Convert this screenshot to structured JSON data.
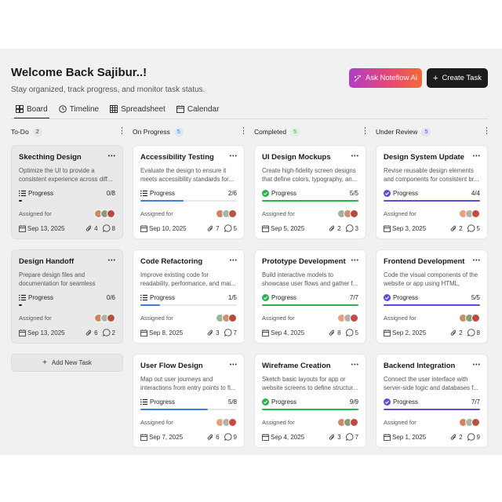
{
  "header": {
    "title": "Welcome Back Sajibur..!",
    "subtitle": "Stay organized, track progress, and monitor task status.",
    "ask_label": "Ask Noteflow Ai",
    "create_label": "Create Task"
  },
  "tabs": [
    {
      "label": "Board",
      "icon": "board-icon",
      "active": true
    },
    {
      "label": "Timeline",
      "icon": "clock-icon",
      "active": false
    },
    {
      "label": "Spreadsheet",
      "icon": "grid-icon",
      "active": false
    },
    {
      "label": "Calendar",
      "icon": "calendar-icon",
      "active": false
    }
  ],
  "colors": {
    "todo_bar": "#1c1c1c",
    "progress_bar": "#3b7ddd",
    "completed_bar": "#2bb34a",
    "review_bar": "#5a4ed8",
    "progress_badge_bg": "#dbe8fb",
    "progress_badge_fg": "#3b7ddd",
    "completed_badge_bg": "#dbf3df",
    "completed_badge_fg": "#2bb34a",
    "review_badge_bg": "#e4e1f9",
    "review_badge_fg": "#5a4ed8"
  },
  "columns": [
    {
      "name": "To-Do",
      "count": "2",
      "cards": [
        {
          "title": "Skecthing Design",
          "desc": "Optimize the UI to provide a consistent experience across diff...",
          "progress_label": "Progress",
          "progress_text": "0/8",
          "progress": 0.03,
          "assigned_label": "Assigned for",
          "date": "Sep 13, 2025",
          "attachments": "4",
          "comments": "8"
        },
        {
          "title": "Design Handoff",
          "desc": "Prepare design files and documentation for seamless trans...",
          "progress_label": "Progress",
          "progress_text": "0/6",
          "progress": 0.03,
          "assigned_label": "Assigned for",
          "date": "Sep 13, 2025",
          "attachments": "6",
          "comments": "2"
        }
      ],
      "add_label": "Add New Task"
    },
    {
      "name": "On Progress",
      "count": "5",
      "cards": [
        {
          "title": "Accessibility Testing",
          "desc": "Evaluate the design to ensure it meets accessibility standards for...",
          "progress_label": "Progress",
          "progress_text": "2/6",
          "progress": 0.45,
          "assigned_label": "Assigned for",
          "date": "Sep 10, 2025",
          "attachments": "7",
          "comments": "5"
        },
        {
          "title": "Code Refactoring",
          "desc": "Improve existing code for readability, performance, and mai...",
          "progress_label": "Progress",
          "progress_text": "1/5",
          "progress": 0.2,
          "assigned_label": "Assigned for",
          "date": "Sep 8, 2025",
          "attachments": "3",
          "comments": "7"
        },
        {
          "title": "User Flow Design",
          "desc": "Map out user journeys and interactions from entry points to fi...",
          "progress_label": "Progress",
          "progress_text": "5/8",
          "progress": 0.7,
          "assigned_label": "Assigned for",
          "date": "Sep 7, 2025",
          "attachments": "6",
          "comments": "9"
        }
      ]
    },
    {
      "name": "Completed",
      "count": "5",
      "cards": [
        {
          "title": "UI Design Mockups",
          "desc": "Create high-fidelity screen designs that define colors, typography, an...",
          "progress_label": "Progress",
          "progress_text": "5/5",
          "progress": 1,
          "assigned_label": "Assigned for",
          "date": "Sep 5, 2025",
          "attachments": "2",
          "comments": "3"
        },
        {
          "title": "Prototype Development",
          "desc": "Build interactive models to showcase user flows and gather f...",
          "progress_label": "Progress",
          "progress_text": "7/7",
          "progress": 1,
          "assigned_label": "Assigned for",
          "date": "Sep 4, 2025",
          "attachments": "8",
          "comments": "5"
        },
        {
          "title": "Wireframe Creation",
          "desc": "Sketch basic layouts for app or website screens to define structur...",
          "progress_label": "Progress",
          "progress_text": "9/9",
          "progress": 1,
          "assigned_label": "Assigned for",
          "date": "Sep 4, 2025",
          "attachments": "3",
          "comments": "7"
        }
      ]
    },
    {
      "name": "Under Review",
      "count": "5",
      "cards": [
        {
          "title": "Design System Update",
          "desc": "Revise reusable design elements and components for consistent br...",
          "progress_label": "Progress",
          "progress_text": "4/4",
          "progress": 1,
          "assigned_label": "Assigned for",
          "date": "Sep 3, 2025",
          "attachments": "2",
          "comments": "5"
        },
        {
          "title": "Frontend Development",
          "desc": "Code the visual components of the website or app using HTML, CSS,...",
          "progress_label": "Progress",
          "progress_text": "5/5",
          "progress": 1,
          "assigned_label": "Assigned for",
          "date": "Sep 2, 2025",
          "attachments": "2",
          "comments": "8"
        },
        {
          "title": "Backend Integration",
          "desc": "Connect the user interface with server-side logic and databases f...",
          "progress_label": "Progress",
          "progress_text": "7/7",
          "progress": 1,
          "assigned_label": "Assigned for",
          "date": "Sep 1, 2025",
          "attachments": "2",
          "comments": "9"
        }
      ]
    }
  ]
}
